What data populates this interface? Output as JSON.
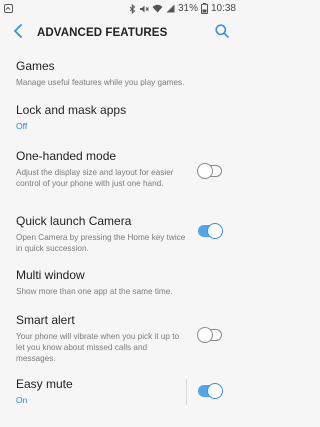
{
  "status_bar": {
    "battery_percent": "31%",
    "time": "10:38"
  },
  "header": {
    "title": "ADVANCED FEATURES"
  },
  "items": [
    {
      "title": "Games",
      "description": "Manage useful features while you play games."
    },
    {
      "title": "Lock and mask apps",
      "value": "Off"
    },
    {
      "title": "One-handed mode",
      "description": "Adjust the display size and layout for easier control of your phone with just one hand.",
      "toggle": false
    },
    {
      "title": "Quick launch Camera",
      "description": "Open Camera by pressing the Home key twice in quick succession.",
      "toggle": true
    },
    {
      "title": "Multi window",
      "description": "Show more than one app at the same time."
    },
    {
      "title": "Smart alert",
      "description": "Your phone will vibrate when you pick it up to let you know about missed calls and messages.",
      "toggle": false
    },
    {
      "title": "Easy mute",
      "value": "On",
      "toggle": true
    }
  ],
  "icons": {
    "back": "arrow-left-icon",
    "search": "magnifier-icon"
  },
  "colors": {
    "accent": "#2f87d6",
    "toggle_on": "#55a6e8",
    "background": "#f6f6f6"
  }
}
